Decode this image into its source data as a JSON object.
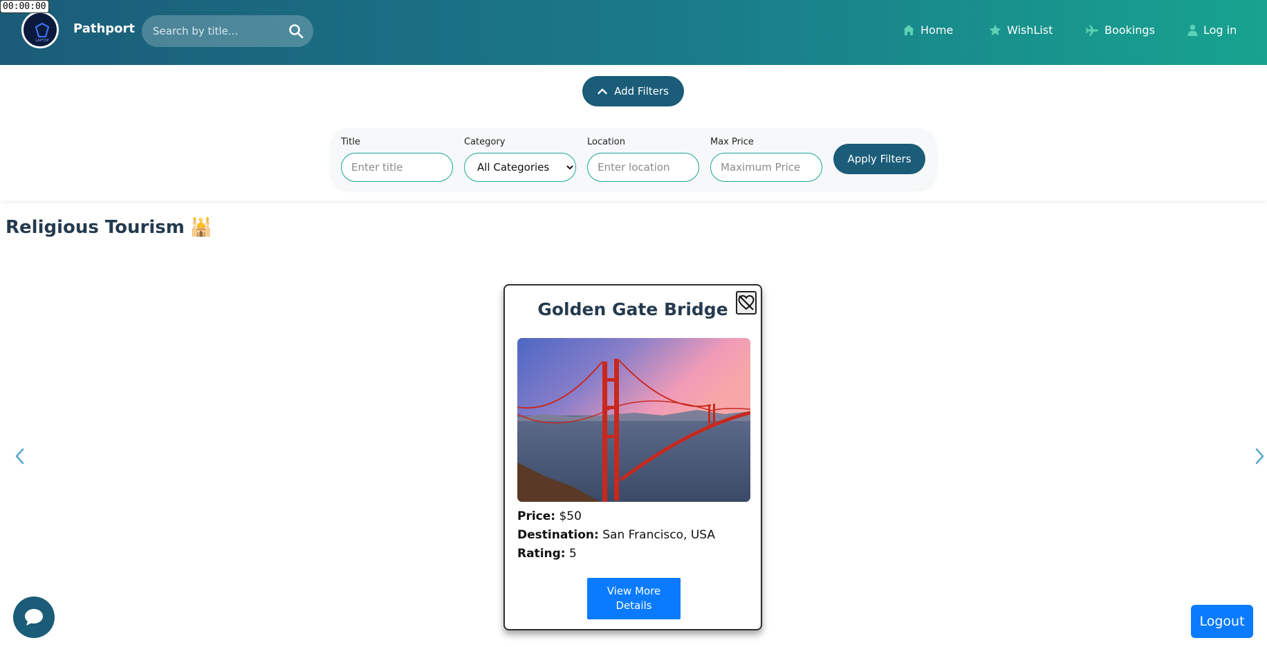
{
  "timer": "00:00:00",
  "header": {
    "brand": "Pathport",
    "logo_text": "LAPTOP",
    "search_placeholder": "Search by title...",
    "nav": [
      {
        "label": "Home",
        "icon": "home-icon"
      },
      {
        "label": "WishList",
        "icon": "star-icon"
      },
      {
        "label": "Bookings",
        "icon": "plane-icon"
      },
      {
        "label": "Log in",
        "icon": "user-icon"
      }
    ]
  },
  "filters": {
    "toggle_label": "Add Filters",
    "title_label": "Title",
    "title_placeholder": "Enter title",
    "category_label": "Category",
    "category_selected": "All Categories",
    "location_label": "Location",
    "location_placeholder": "Enter location",
    "price_label": "Max Price",
    "price_placeholder": "Maximum Price",
    "apply_label": "Apply Filters"
  },
  "section": {
    "title": "Religious Tourism",
    "emoji": "🕌"
  },
  "card": {
    "title": "Golden Gate Bridge",
    "price_label": "Price:",
    "price_value": "$50",
    "destination_label": "Destination:",
    "destination_value": "San Francisco, USA",
    "rating_label": "Rating:",
    "rating_value": "5",
    "button_label": "View More Details"
  },
  "logout_label": "Logout",
  "colors": {
    "primary": "#1b5c78",
    "accent_teal": "#17a38f",
    "blue_button": "#0a7bff"
  }
}
